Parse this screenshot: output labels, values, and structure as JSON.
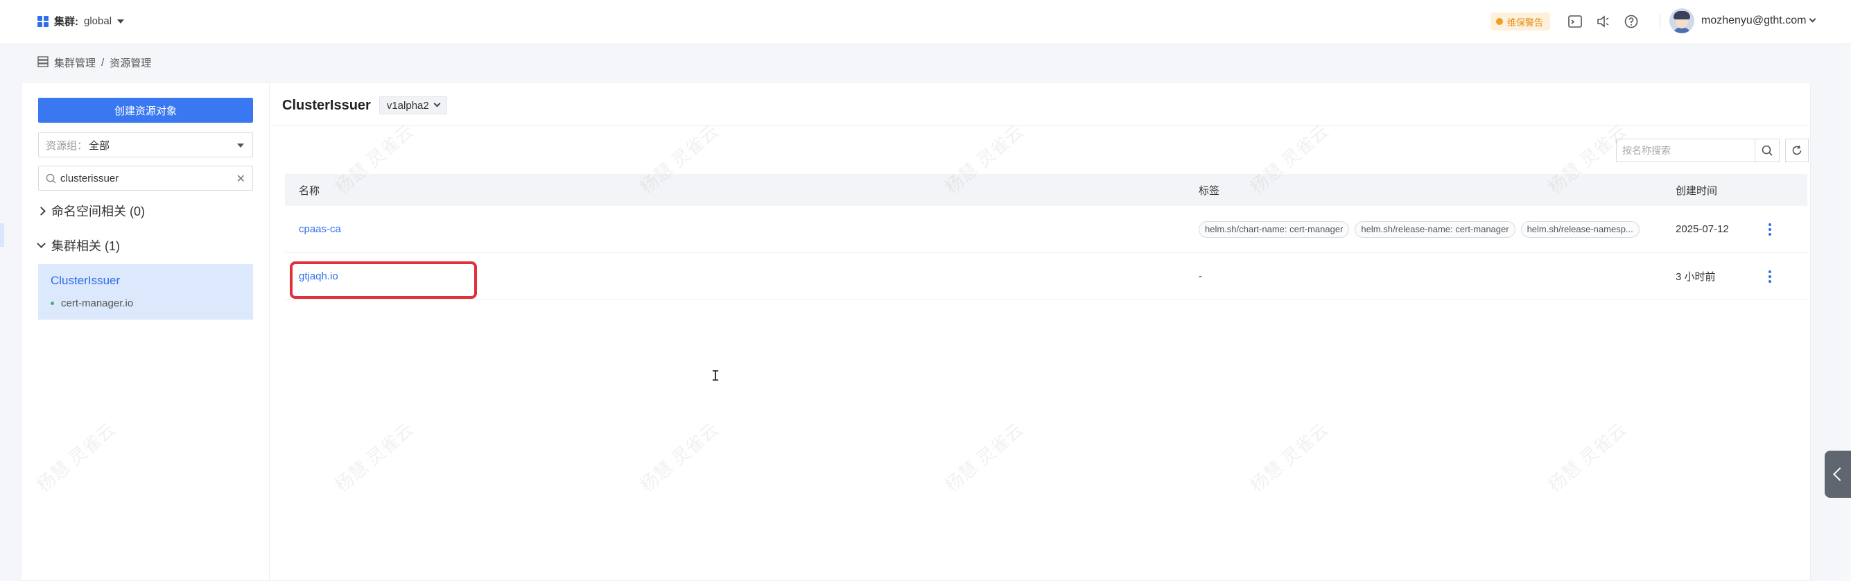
{
  "header": {
    "cluster_label": "集群:",
    "cluster_value": "global",
    "warning_badge": "维保警告",
    "user_email": "mozhenyu@gtht.com"
  },
  "breadcrumb": {
    "parent": "集群管理",
    "separator": "/",
    "current": "资源管理"
  },
  "sidebar": {
    "create_button": "创建资源对象",
    "resource_group_label": "资源组：",
    "resource_group_value": "全部",
    "filter_value": "clusterissuer",
    "groups": [
      {
        "label": "命名空间相关 (0)",
        "expanded": false
      },
      {
        "label": "集群相关 (1)",
        "expanded": true
      }
    ],
    "active_item": {
      "title": "ClusterIssuer",
      "api_group": "cert-manager.io"
    }
  },
  "content": {
    "resource_title": "ClusterIssuer",
    "version": "v1alpha2",
    "search_placeholder": "按名称搜索",
    "columns": {
      "name": "名称",
      "labels": "标签",
      "created": "创建时间"
    },
    "rows": [
      {
        "name": "cpaas-ca",
        "tags": [
          "helm.sh/chart-name: cert-manager",
          "helm.sh/release-name: cert-manager",
          "helm.sh/release-namesp..."
        ],
        "created": "2025-07-12"
      },
      {
        "name": "gtjaqh.io",
        "tags_text": "-",
        "created": "3 小时前"
      }
    ]
  },
  "watermark_text": "杨慧 灵雀云",
  "colors": {
    "accent": "#3a78f2",
    "highlight": "#e0303a",
    "warning": "#e58b14"
  }
}
